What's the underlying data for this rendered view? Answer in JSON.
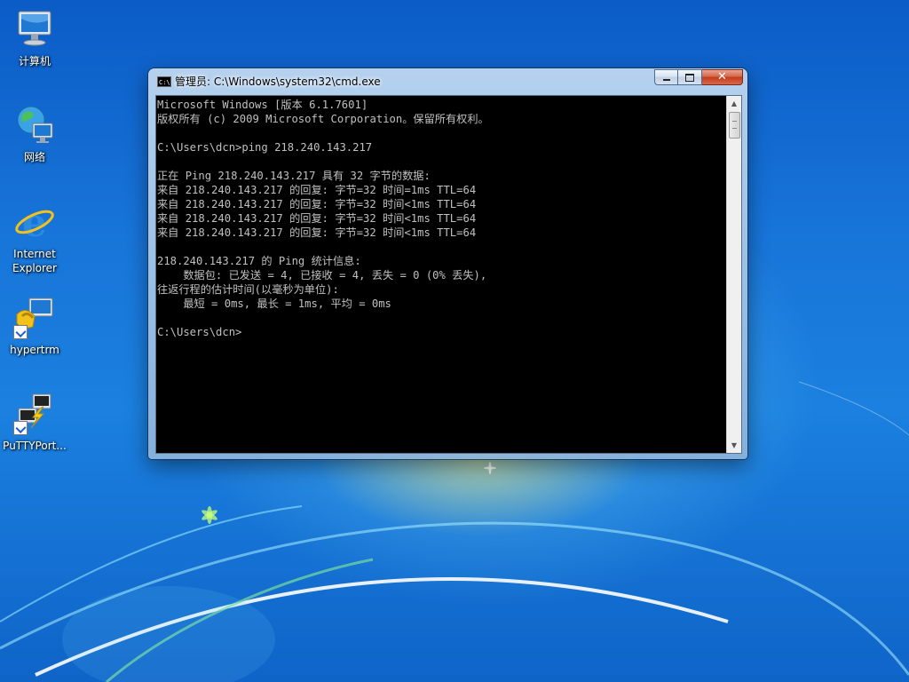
{
  "desktop": {
    "icons": [
      {
        "label": "计算机",
        "icon": "computer-icon"
      },
      {
        "label": "网络",
        "icon": "network-icon"
      },
      {
        "label": "Internet Explorer",
        "icon": "internet-explorer-icon"
      },
      {
        "label": "hypertrm",
        "icon": "hyperterminal-icon"
      },
      {
        "label": "PuTTYPort...",
        "icon": "putty-icon"
      }
    ]
  },
  "window": {
    "title": "管理员: C:\\Windows\\system32\\cmd.exe",
    "app_icon_text": "C:\\",
    "buttons": {
      "minimize": "minimize",
      "maximize": "maximize",
      "close": "✕"
    },
    "console_lines": [
      "Microsoft Windows [版本 6.1.7601]",
      "版权所有 (c) 2009 Microsoft Corporation。保留所有权利。",
      "",
      "C:\\Users\\dcn>ping 218.240.143.217",
      "",
      "正在 Ping 218.240.143.217 具有 32 字节的数据:",
      "来自 218.240.143.217 的回复: 字节=32 时间=1ms TTL=64",
      "来自 218.240.143.217 的回复: 字节=32 时间<1ms TTL=64",
      "来自 218.240.143.217 的回复: 字节=32 时间<1ms TTL=64",
      "来自 218.240.143.217 的回复: 字节=32 时间<1ms TTL=64",
      "",
      "218.240.143.217 的 Ping 统计信息:",
      "    数据包: 已发送 = 4, 已接收 = 4, 丢失 = 0 (0% 丢失),",
      "往返行程的估计时间(以毫秒为单位):",
      "    最短 = 0ms, 最长 = 1ms, 平均 = 0ms",
      "",
      "C:\\Users\\dcn>"
    ],
    "scrollbar": {
      "up_arrow": "▲",
      "down_arrow": "▼"
    }
  }
}
